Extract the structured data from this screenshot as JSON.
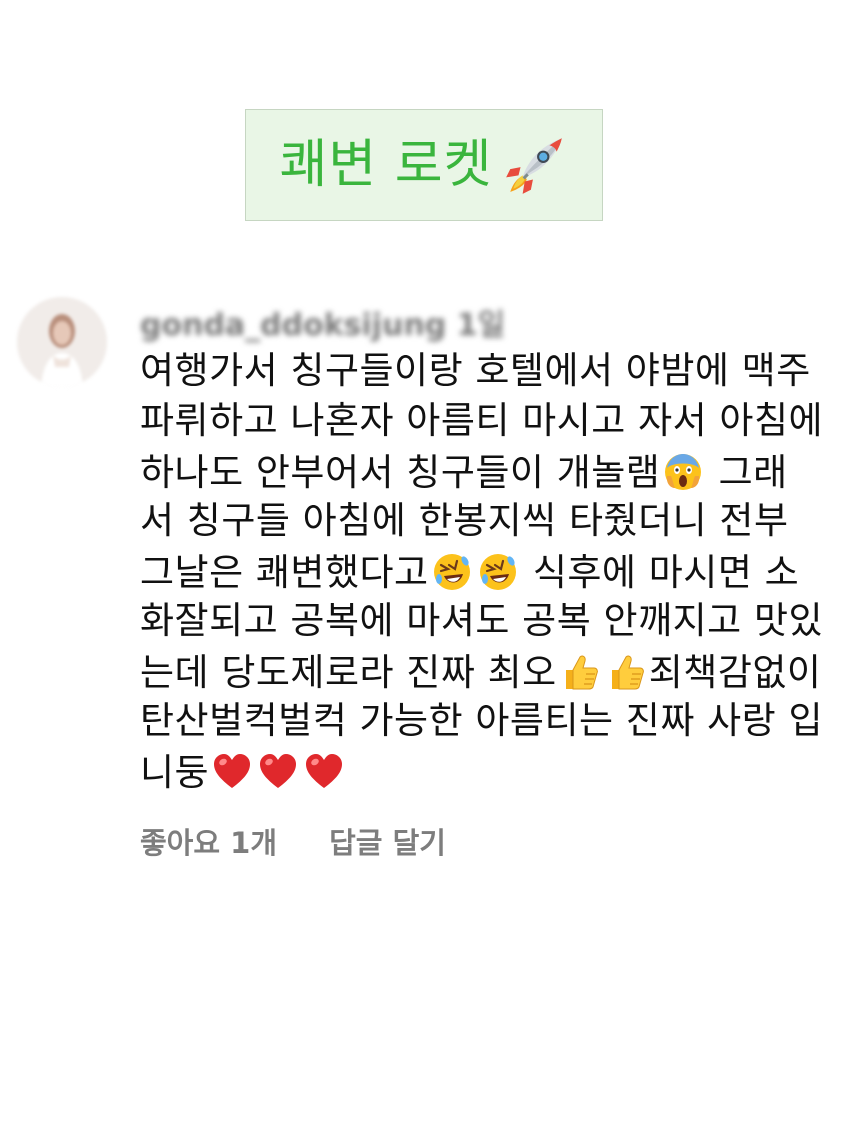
{
  "banner": {
    "text": "쾌변 로켓",
    "text_color": "#3ab53d",
    "background": "#e9f6e6",
    "icon": "rocket-icon"
  },
  "comment": {
    "username": "gonda_ddoksijung",
    "time": "1일",
    "lines": [
      [
        "여행가서 칭구들이랑 호텔에서 야밤에 맥주"
      ],
      [
        "파뤼하고 나혼자 아름티 마시고 자서 아침에"
      ],
      [
        "하나도 안부어서 칭구들이 개놀램",
        "{scream}",
        " 그래"
      ],
      [
        "서 칭구들 아침에 한봉지씩 타줬더니 전부"
      ],
      [
        "그날은 쾌변했다고",
        "{rofl}",
        "{rofl}",
        " 식후에 마시면 소"
      ],
      [
        "화잘되고 공복에 마셔도 공복 안깨지고 맛있"
      ],
      [
        "는데 당도제로라 진짜 최오",
        "{thumbs}",
        "{thumbs}",
        "죄책감없이"
      ],
      [
        "탄산벌컥벌컥 가능한 아름티는 진짜 사랑 입"
      ],
      [
        "니둥",
        "{heart}",
        "{heart}",
        "{heart}"
      ]
    ],
    "likes": "좋아요 1개",
    "reply": "답글 달기"
  }
}
